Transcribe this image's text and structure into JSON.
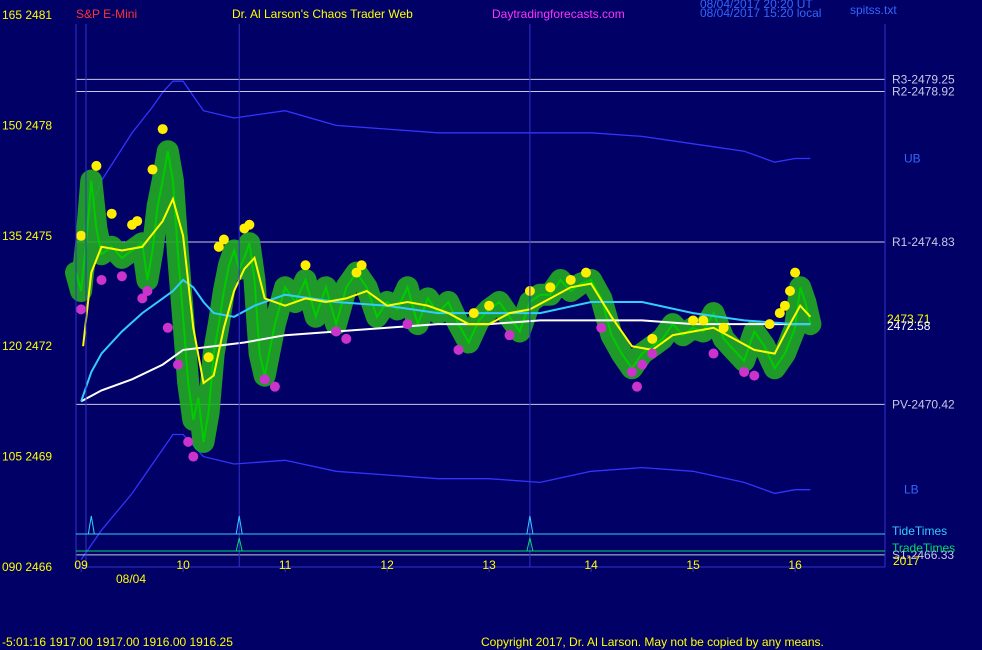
{
  "header": {
    "left_label": "S&P E-Mini",
    "center_label": "Dr. Al Larson's Chaos Trader Web",
    "right_label": "Daytradingforecasts.com",
    "timestamp_utc": "08/04/2017 20:20 UT",
    "timestamp_local": "08/04/2017 15:20 local",
    "file_label": "spitss.txt"
  },
  "footer": {
    "readout": "-5:01:16  1917.00 1917.00 1916.00 1916.25",
    "copyright": "Copyright 2017, Dr. Al Larson. May not be copied by any means.",
    "date_label": "08/04",
    "year_label": "2017"
  },
  "colors": {
    "background": "#000066",
    "axes": "#3333cc",
    "grid": "#c8c8e6",
    "price": "#00cc00",
    "halo": "#22aa22",
    "yellow_line": "#ffff00",
    "cyan_line": "#33ccff",
    "white_line": "#ffffff",
    "band": "#3333ff",
    "peak_dot": "#ffee00",
    "trough_dot": "#cc33cc",
    "tide": "#33ccff",
    "trade": "#00dd66",
    "label": "#ffff00",
    "level_label": "#c8c8e6",
    "band_label": "#3366ff",
    "header_left": "#ff3333",
    "header_right": "#ff33ff"
  },
  "chart_data": {
    "type": "line",
    "title": "S&P E-Mini",
    "xlim": [
      8.95,
      16.2
    ],
    "ylim": [
      2466,
      2481
    ],
    "x_ticks": [
      {
        "x": 9,
        "label": "09"
      },
      {
        "x": 10,
        "label": "10"
      },
      {
        "x": 11,
        "label": "11"
      },
      {
        "x": 12,
        "label": "12"
      },
      {
        "x": 13,
        "label": "13"
      },
      {
        "x": 14,
        "label": "14"
      },
      {
        "x": 15,
        "label": "15"
      },
      {
        "x": 16,
        "label": "16"
      }
    ],
    "y_ticks": [
      {
        "y": 2481,
        "osc": "165"
      },
      {
        "y": 2478,
        "osc": "150"
      },
      {
        "y": 2475,
        "osc": "135"
      },
      {
        "y": 2472,
        "osc": "120"
      },
      {
        "y": 2469,
        "osc": "105"
      },
      {
        "y": 2466,
        "osc": "090"
      }
    ],
    "levels": [
      {
        "name": "R3",
        "value": 2479.25,
        "label": "R3-2479.25"
      },
      {
        "name": "R2",
        "value": 2478.92,
        "label": "R2-2478.92"
      },
      {
        "name": "R1",
        "value": 2474.83,
        "label": "R1-2474.83"
      },
      {
        "name": "PV",
        "value": 2470.42,
        "label": "PV-2470.42"
      },
      {
        "name": "S1",
        "value": 2466.33,
        "label": "S1-2466.33"
      }
    ],
    "band_labels": [
      {
        "label": "UB",
        "y": 2477.1
      },
      {
        "label": "LB",
        "y": 2468.1
      }
    ],
    "last_value_labels": [
      "2473.71",
      "2472.58"
    ],
    "tide_times": [
      9.1,
      10.55,
      13.4
    ],
    "trade_times": [
      10.55,
      13.4
    ],
    "tide_label": "TideTimes",
    "trade_label": "TradeTimes",
    "series": [
      {
        "name": "price",
        "x": [
          8.95,
          9.0,
          9.05,
          9.1,
          9.15,
          9.2,
          9.3,
          9.4,
          9.5,
          9.6,
          9.65,
          9.7,
          9.75,
          9.8,
          9.85,
          9.9,
          9.95,
          10.0,
          10.05,
          10.1,
          10.15,
          10.2,
          10.25,
          10.3,
          10.35,
          10.4,
          10.45,
          10.5,
          10.55,
          10.6,
          10.65,
          10.7,
          10.75,
          10.8,
          10.9,
          11.0,
          11.1,
          11.2,
          11.3,
          11.4,
          11.5,
          11.6,
          11.7,
          11.8,
          11.9,
          12.0,
          12.1,
          12.2,
          12.3,
          12.4,
          12.5,
          12.6,
          12.7,
          12.8,
          12.9,
          13.0,
          13.1,
          13.2,
          13.3,
          13.4,
          13.5,
          13.6,
          13.7,
          13.8,
          13.9,
          14.0,
          14.1,
          14.2,
          14.3,
          14.4,
          14.5,
          14.6,
          14.7,
          14.8,
          14.9,
          15.0,
          15.1,
          15.2,
          15.3,
          15.4,
          15.5,
          15.6,
          15.7,
          15.8,
          15.9,
          16.0,
          16.05,
          16.1,
          16.15
        ],
        "values": [
          2474.0,
          2473.5,
          2474.8,
          2476.5,
          2475.2,
          2474.5,
          2474.7,
          2474.4,
          2474.6,
          2474.8,
          2473.8,
          2474.6,
          2475.8,
          2476.5,
          2477.3,
          2476.5,
          2474.5,
          2472.8,
          2471.0,
          2470.0,
          2470.6,
          2469.4,
          2470.2,
          2471.8,
          2472.6,
          2473.5,
          2474.2,
          2474.6,
          2474.1,
          2474.4,
          2474.8,
          2473.8,
          2471.8,
          2471.2,
          2472.6,
          2473.6,
          2473.2,
          2473.8,
          2472.8,
          2473.6,
          2472.6,
          2473.6,
          2474.0,
          2473.6,
          2472.8,
          2473.2,
          2473.0,
          2473.6,
          2472.6,
          2473.3,
          2472.9,
          2473.2,
          2472.6,
          2472.1,
          2472.7,
          2473.0,
          2473.2,
          2472.8,
          2472.4,
          2473.2,
          2473.4,
          2473.4,
          2473.8,
          2473.5,
          2473.7,
          2473.8,
          2473.3,
          2472.3,
          2471.8,
          2471.4,
          2471.8,
          2472.0,
          2472.2,
          2472.6,
          2472.3,
          2472.5,
          2472.4,
          2472.9,
          2472.2,
          2471.9,
          2471.6,
          2472.4,
          2472.0,
          2471.4,
          2471.8,
          2472.5,
          2473.6,
          2473.2,
          2472.6
        ]
      },
      {
        "name": "yellow_avg",
        "x": [
          9.02,
          9.1,
          9.2,
          9.4,
          9.6,
          9.8,
          9.9,
          10.0,
          10.1,
          10.2,
          10.3,
          10.4,
          10.5,
          10.6,
          10.7,
          10.8,
          11.0,
          11.2,
          11.4,
          11.6,
          11.8,
          12.0,
          12.2,
          12.4,
          12.6,
          12.8,
          13.0,
          13.2,
          13.4,
          13.6,
          13.8,
          14.0,
          14.2,
          14.4,
          14.6,
          14.8,
          15.0,
          15.2,
          15.4,
          15.6,
          15.8,
          15.95,
          16.05,
          16.15
        ],
        "values": [
          2472.0,
          2474.0,
          2474.7,
          2474.6,
          2474.7,
          2475.4,
          2476.0,
          2475.0,
          2472.5,
          2471.0,
          2471.2,
          2472.5,
          2473.5,
          2474.1,
          2474.4,
          2473.3,
          2473.1,
          2473.3,
          2473.2,
          2473.3,
          2473.5,
          2473.1,
          2473.2,
          2473.1,
          2472.9,
          2472.6,
          2472.6,
          2472.9,
          2473.0,
          2473.3,
          2473.6,
          2473.7,
          2472.8,
          2472.0,
          2471.9,
          2472.3,
          2472.4,
          2472.5,
          2472.2,
          2471.9,
          2471.8,
          2472.6,
          2473.1,
          2472.8
        ]
      },
      {
        "name": "cyan_avg",
        "x": [
          9.0,
          9.1,
          9.2,
          9.4,
          9.6,
          9.8,
          9.9,
          10.0,
          10.1,
          10.2,
          10.3,
          10.5,
          10.7,
          11.0,
          11.5,
          12.0,
          12.5,
          13.0,
          13.5,
          14.0,
          14.5,
          15.0,
          15.5,
          16.0,
          16.15
        ],
        "values": [
          2470.5,
          2471.3,
          2471.8,
          2472.4,
          2472.9,
          2473.3,
          2473.5,
          2473.8,
          2473.6,
          2473.2,
          2472.9,
          2472.8,
          2473.1,
          2473.4,
          2473.2,
          2473.1,
          2472.9,
          2472.9,
          2472.9,
          2473.2,
          2473.2,
          2472.9,
          2472.7,
          2472.6,
          2472.6
        ]
      },
      {
        "name": "white_avg",
        "x": [
          9.0,
          9.2,
          9.5,
          9.8,
          10.0,
          10.3,
          10.6,
          11.0,
          11.5,
          12.0,
          12.5,
          13.0,
          13.5,
          14.0,
          14.5,
          15.0,
          15.5,
          16.0,
          16.15
        ],
        "values": [
          2470.5,
          2470.8,
          2471.1,
          2471.5,
          2471.9,
          2472.0,
          2472.1,
          2472.3,
          2472.4,
          2472.5,
          2472.6,
          2472.6,
          2472.7,
          2472.7,
          2472.7,
          2472.6,
          2472.6,
          2472.6,
          2472.6
        ]
      },
      {
        "name": "upper_band",
        "x": [
          9.0,
          9.2,
          9.5,
          9.7,
          9.8,
          9.9,
          10.0,
          10.2,
          10.5,
          11.0,
          11.5,
          12.0,
          12.5,
          13.0,
          13.5,
          14.0,
          14.5,
          15.0,
          15.5,
          15.8,
          16.0,
          16.15
        ],
        "values": [
          2475.0,
          2476.5,
          2477.8,
          2478.5,
          2478.9,
          2479.2,
          2479.2,
          2478.4,
          2478.2,
          2478.4,
          2478.0,
          2477.9,
          2477.8,
          2477.8,
          2477.8,
          2477.8,
          2477.7,
          2477.5,
          2477.3,
          2477.0,
          2477.1,
          2477.1
        ]
      },
      {
        "name": "lower_band",
        "x": [
          9.0,
          9.2,
          9.5,
          9.7,
          9.8,
          9.9,
          10.0,
          10.2,
          10.5,
          11.0,
          11.5,
          12.0,
          12.5,
          13.0,
          13.5,
          14.0,
          14.5,
          15.0,
          15.5,
          15.8,
          16.0,
          16.15
        ],
        "values": [
          2466.2,
          2467.0,
          2468.0,
          2468.8,
          2469.2,
          2469.6,
          2469.6,
          2469.0,
          2468.8,
          2468.9,
          2468.6,
          2468.5,
          2468.4,
          2468.4,
          2468.3,
          2468.6,
          2468.7,
          2468.6,
          2468.3,
          2468.0,
          2468.1,
          2468.1
        ]
      }
    ],
    "peaks": [
      {
        "x": 9.0,
        "y": 2475.0
      },
      {
        "x": 9.15,
        "y": 2476.9
      },
      {
        "x": 9.3,
        "y": 2475.6
      },
      {
        "x": 9.5,
        "y": 2475.3
      },
      {
        "x": 9.55,
        "y": 2475.4
      },
      {
        "x": 9.7,
        "y": 2476.8
      },
      {
        "x": 9.8,
        "y": 2477.9
      },
      {
        "x": 10.25,
        "y": 2471.7
      },
      {
        "x": 10.35,
        "y": 2474.7
      },
      {
        "x": 10.4,
        "y": 2474.9
      },
      {
        "x": 10.6,
        "y": 2475.2
      },
      {
        "x": 10.65,
        "y": 2475.3
      },
      {
        "x": 11.2,
        "y": 2474.2
      },
      {
        "x": 11.7,
        "y": 2474.0
      },
      {
        "x": 11.75,
        "y": 2474.2
      },
      {
        "x": 12.85,
        "y": 2472.9
      },
      {
        "x": 13.0,
        "y": 2473.1
      },
      {
        "x": 13.4,
        "y": 2473.5
      },
      {
        "x": 13.6,
        "y": 2473.6
      },
      {
        "x": 13.8,
        "y": 2473.8
      },
      {
        "x": 13.95,
        "y": 2474.0
      },
      {
        "x": 14.6,
        "y": 2472.2
      },
      {
        "x": 15.0,
        "y": 2472.7
      },
      {
        "x": 15.1,
        "y": 2472.7
      },
      {
        "x": 15.3,
        "y": 2472.5
      },
      {
        "x": 15.75,
        "y": 2472.6
      },
      {
        "x": 15.85,
        "y": 2472.9
      },
      {
        "x": 15.9,
        "y": 2473.1
      },
      {
        "x": 15.95,
        "y": 2473.5
      },
      {
        "x": 16.0,
        "y": 2474.0
      }
    ],
    "troughs": [
      {
        "x": 9.0,
        "y": 2473.0
      },
      {
        "x": 9.2,
        "y": 2473.8
      },
      {
        "x": 9.4,
        "y": 2473.9
      },
      {
        "x": 9.6,
        "y": 2473.3
      },
      {
        "x": 9.65,
        "y": 2473.5
      },
      {
        "x": 9.85,
        "y": 2472.5
      },
      {
        "x": 9.95,
        "y": 2471.5
      },
      {
        "x": 10.05,
        "y": 2469.4
      },
      {
        "x": 10.1,
        "y": 2469.0
      },
      {
        "x": 10.8,
        "y": 2471.1
      },
      {
        "x": 10.9,
        "y": 2470.9
      },
      {
        "x": 11.5,
        "y": 2472.4
      },
      {
        "x": 11.6,
        "y": 2472.2
      },
      {
        "x": 12.2,
        "y": 2472.6
      },
      {
        "x": 12.7,
        "y": 2471.9
      },
      {
        "x": 13.2,
        "y": 2472.3
      },
      {
        "x": 14.1,
        "y": 2472.5
      },
      {
        "x": 14.4,
        "y": 2471.3
      },
      {
        "x": 14.45,
        "y": 2470.9
      },
      {
        "x": 14.5,
        "y": 2471.5
      },
      {
        "x": 14.6,
        "y": 2471.8
      },
      {
        "x": 15.2,
        "y": 2471.8
      },
      {
        "x": 15.5,
        "y": 2471.3
      },
      {
        "x": 15.6,
        "y": 2471.2
      }
    ]
  }
}
